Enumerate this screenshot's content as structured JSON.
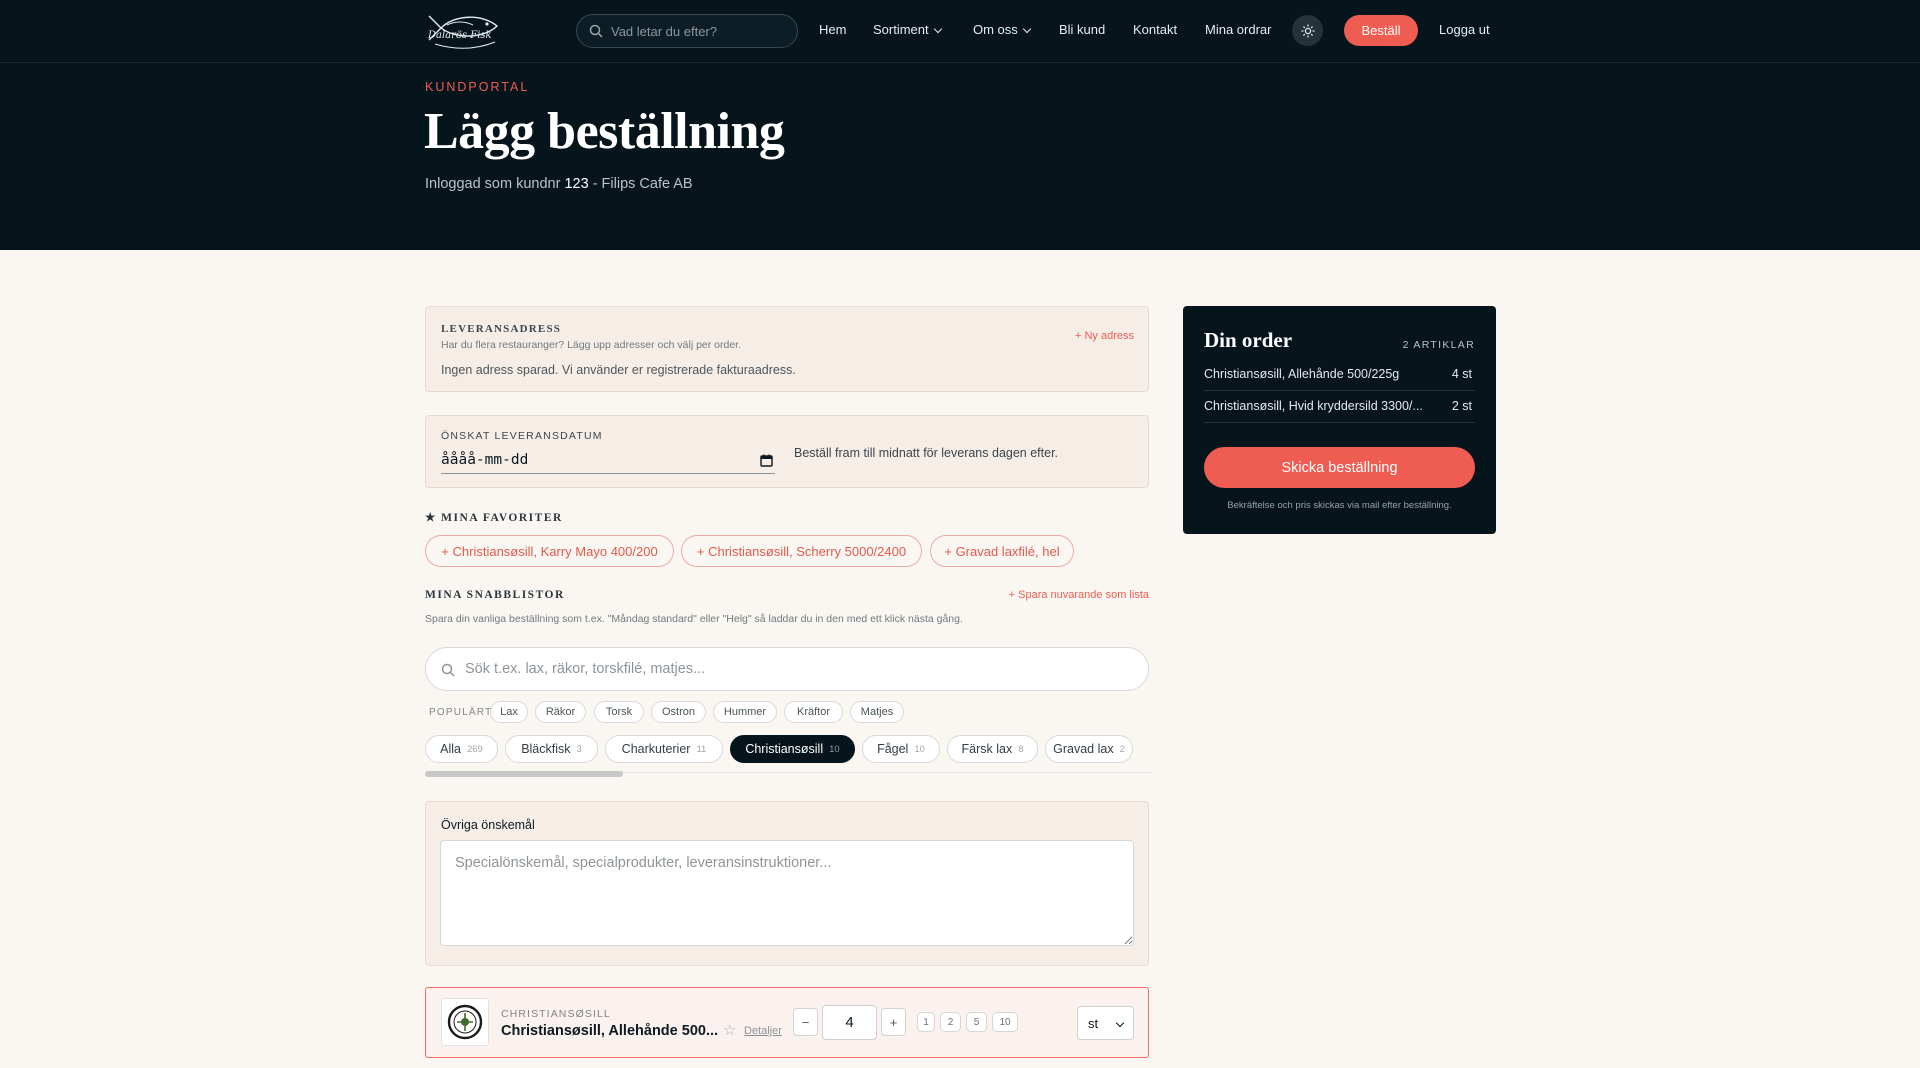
{
  "nav": {
    "logo_text": "Dalarös Fisk",
    "search_placeholder": "Vad letar du efter?",
    "links": [
      "Hem",
      "Sortiment",
      "Om oss",
      "Bli kund",
      "Kontakt",
      "Mina ordrar"
    ],
    "order_button": "Beställ",
    "logout": "Logga ut"
  },
  "hero": {
    "kicker": "KUNDPORTAL",
    "title": "Lägg beställning",
    "subtitle_prefix": "Inloggad som kundnr",
    "customer_number": "123",
    "subtitle_suffix": "- Filips Cafe AB"
  },
  "delivery_address": {
    "label": "LEVERANSADRESS",
    "help": "Har du flera restauranger? Lägg upp adresser och välj per order.",
    "new_address": "+ Ny adress",
    "empty_text": "Ingen adress sparad. Vi använder er registrerade fakturaadress."
  },
  "delivery_date": {
    "label": "ÖNSKAT LEVERANSDATUM",
    "placeholder": "åååå-mm-dd",
    "hint": "Beställ fram till midnatt för leverans dagen efter."
  },
  "favorites": {
    "heading": "★ MINA FAVORITER",
    "items": [
      "+ Christiansøsill, Karry Mayo 400/200",
      "+ Christiansøsill, Scherry 5000/2400",
      "+ Gravad laxfilé, hel"
    ]
  },
  "quicklists": {
    "heading": "MINA SNABBLISTOR",
    "save_link": "+ Spara nuvarande som lista",
    "help": "Spara din vanliga beställning som t.ex. \"Måndag standard\" eller \"Helg\" så laddar du in den med ett klick nästa gång."
  },
  "product_search": {
    "placeholder": "Sök t.ex. lax, räkor, torskfilé, matjes..."
  },
  "popular": {
    "label": "POPULÄRT",
    "items": [
      "Lax",
      "Räkor",
      "Torsk",
      "Ostron",
      "Hummer",
      "Kräftor",
      "Matjes"
    ]
  },
  "categories": [
    {
      "name": "Alla",
      "count": "269"
    },
    {
      "name": "Bläckfisk",
      "count": "3"
    },
    {
      "name": "Charkuterier",
      "count": "11"
    },
    {
      "name": "Christiansøsill",
      "count": "10"
    },
    {
      "name": "Fågel",
      "count": "10"
    },
    {
      "name": "Färsk lax",
      "count": "8"
    },
    {
      "name": "Gravad lax",
      "count": "2"
    }
  ],
  "other_requests": {
    "label": "Övriga önskemål",
    "placeholder": "Specialönskemål, specialprodukter, leveransinstruktioner..."
  },
  "product_row": {
    "category": "CHRISTIANSØSILL",
    "name": "Christiansøsill, Allehånde 500...",
    "details": "Detaljer",
    "minus": "−",
    "plus": "+",
    "quantity": "4",
    "quick_quantities": [
      "1",
      "2",
      "5",
      "10"
    ],
    "unit": "st"
  },
  "order": {
    "title": "Din order",
    "count_label": "2 ARTIKLAR",
    "lines": [
      {
        "name": "Christiansøsill, Allehånde 500/225g",
        "qty": "4 st"
      },
      {
        "name": "Christiansøsill, Hvid kryddersild 3300/...",
        "qty": "2 st"
      }
    ],
    "send_button": "Skicka beställning",
    "note": "Bekräftelse och pris skickas via mail efter beställning."
  },
  "colors": {
    "accent": "#ef5d52",
    "dark": "#06141b",
    "card": "#f7ede7"
  }
}
